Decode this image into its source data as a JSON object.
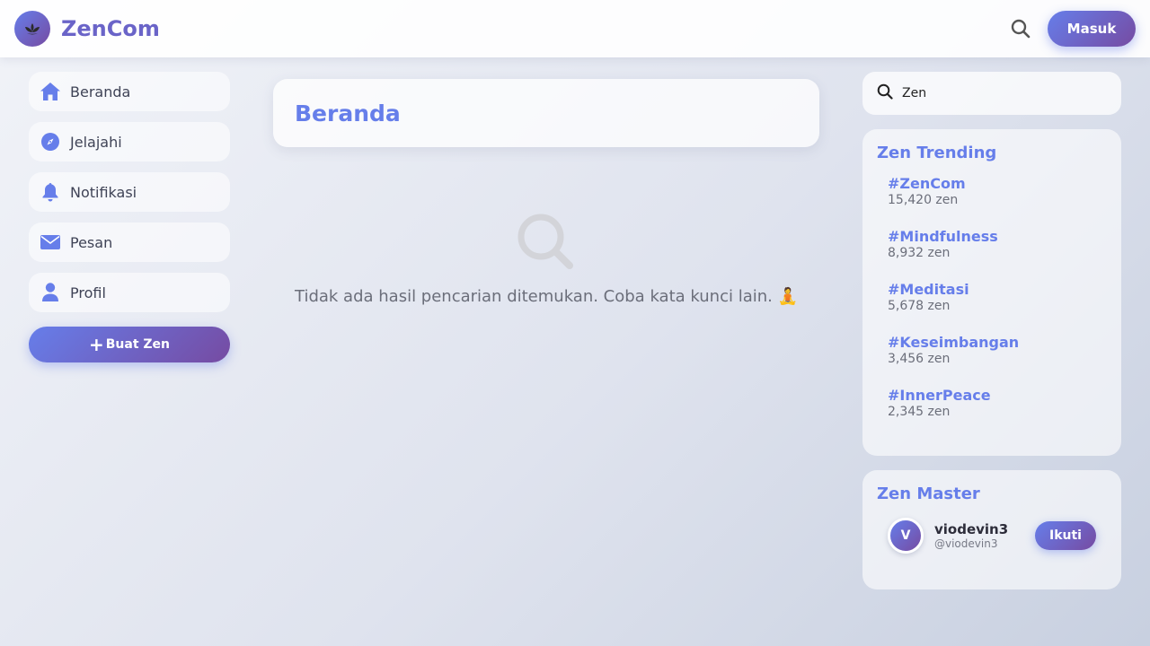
{
  "header": {
    "brand": "ZenCom",
    "logo_icon": "lotus-icon",
    "search_icon": "search-icon",
    "login_label": "Masuk"
  },
  "sidebar": {
    "items": [
      {
        "label": "Beranda",
        "icon": "home-icon"
      },
      {
        "label": "Jelajahi",
        "icon": "compass-icon"
      },
      {
        "label": "Notifikasi",
        "icon": "bell-icon"
      },
      {
        "label": "Pesan",
        "icon": "envelope-icon"
      },
      {
        "label": "Profil",
        "icon": "user-icon"
      }
    ],
    "create_plus": "+",
    "create_label": "Buat Zen"
  },
  "main": {
    "title": "Beranda",
    "empty_message": "Tidak ada hasil pencarian ditemukan. Coba kata kunci lain. 🧘"
  },
  "search": {
    "value": "Zen"
  },
  "trending": {
    "title": "Zen Trending",
    "items": [
      {
        "tag": "#ZenCom",
        "count": "15,420 zen"
      },
      {
        "tag": "#Mindfulness",
        "count": "8,932 zen"
      },
      {
        "tag": "#Meditasi",
        "count": "5,678 zen"
      },
      {
        "tag": "#Keseimbangan",
        "count": "3,456 zen"
      },
      {
        "tag": "#InnerPeace",
        "count": "2,345 zen"
      }
    ]
  },
  "master": {
    "title": "Zen Master",
    "avatar_initial": "V",
    "name": "viodevin3",
    "handle": "@viodevin3",
    "follow_label": "Ikuti"
  },
  "colors": {
    "accent": "#667eea",
    "accent_end": "#764ba2"
  }
}
